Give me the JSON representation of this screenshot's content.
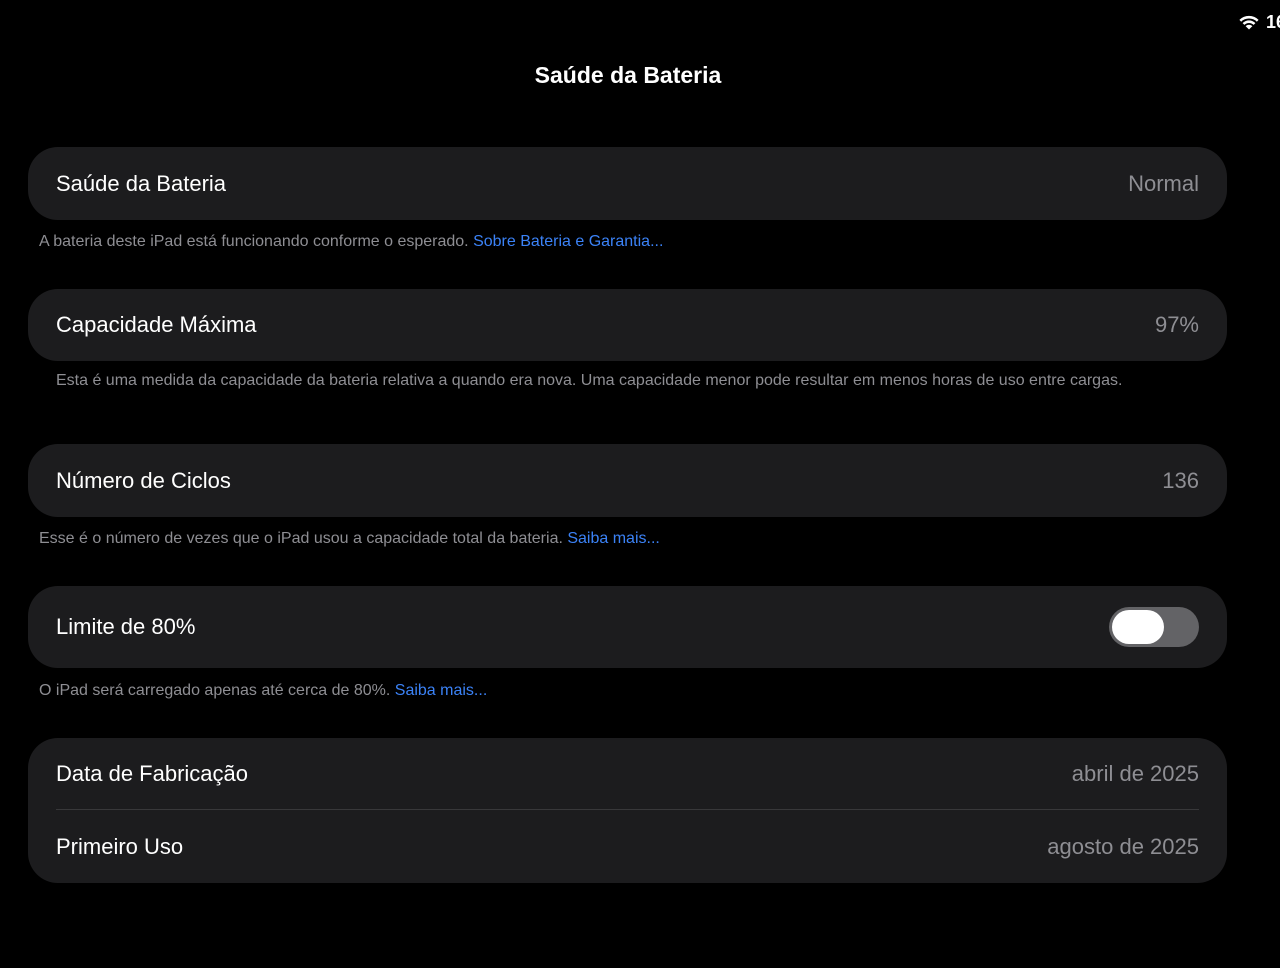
{
  "status_bar": {
    "time": "16"
  },
  "nav": {
    "title": "Saúde da Bateria"
  },
  "battery_health": {
    "label": "Saúde da Bateria",
    "value": "Normal",
    "footer_text": "A bateria deste iPad está funcionando conforme o esperado.",
    "footer_link": "Sobre Bateria e Garantia..."
  },
  "max_capacity": {
    "label": "Capacidade Máxima",
    "value": "97%",
    "footer_text": "Esta é uma medida da capacidade da bateria relativa a quando era nova. Uma capacidade menor pode resultar em menos horas de uso entre cargas."
  },
  "cycle_count": {
    "label": "Número de Ciclos",
    "value": "136",
    "footer_text": "Esse é o número de vezes que o iPad usou a capacidade total da bateria.",
    "footer_link": "Saiba mais..."
  },
  "limit_80": {
    "label": "Limite de 80%",
    "toggle_on": false,
    "footer_text": "O iPad será carregado apenas até cerca de 80%.",
    "footer_link": "Saiba mais..."
  },
  "dates": {
    "manufacture_label": "Data de Fabricação",
    "manufacture_value": "abril de 2025",
    "first_use_label": "Primeiro Uso",
    "first_use_value": "agosto de 2025"
  },
  "colors": {
    "background": "#000000",
    "card": "#1c1c1e",
    "secondary_text": "#8e8e93",
    "link": "#3b82f6",
    "toggle_off": "#636366"
  }
}
